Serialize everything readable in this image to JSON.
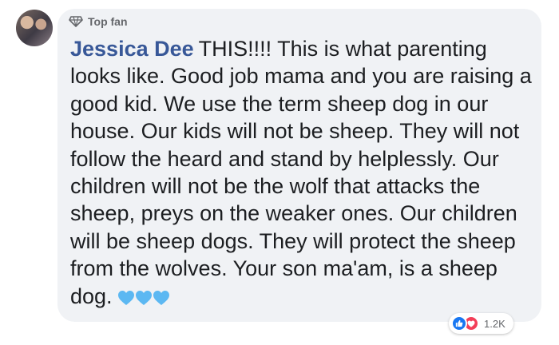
{
  "comment": {
    "badge": "Top fan",
    "author": "Jessica Dee",
    "text": "THIS!!!! This is what parenting looks like. Good job mama and you are raising a good kid. We use the term sheep dog in our house. Our kids will not be sheep. They will not follow the heard and stand by helplessly. Our children will not be the wolf that attacks the sheep, preys on the weaker ones. Our children will be sheep dogs. They will protect the sheep from the wolves. Your son ma'am, is a sheep dog.",
    "emoji": [
      "blue-heart-icon",
      "blue-heart-icon",
      "blue-heart-icon"
    ]
  },
  "reactions": {
    "icons": [
      "like-icon",
      "love-icon"
    ],
    "count": "1.2K"
  },
  "colors": {
    "author": "#385898",
    "bubble": "#f0f2f5",
    "like": "#1877f2",
    "love": "#f33e58",
    "blue_heart": "#5cb8f2"
  }
}
